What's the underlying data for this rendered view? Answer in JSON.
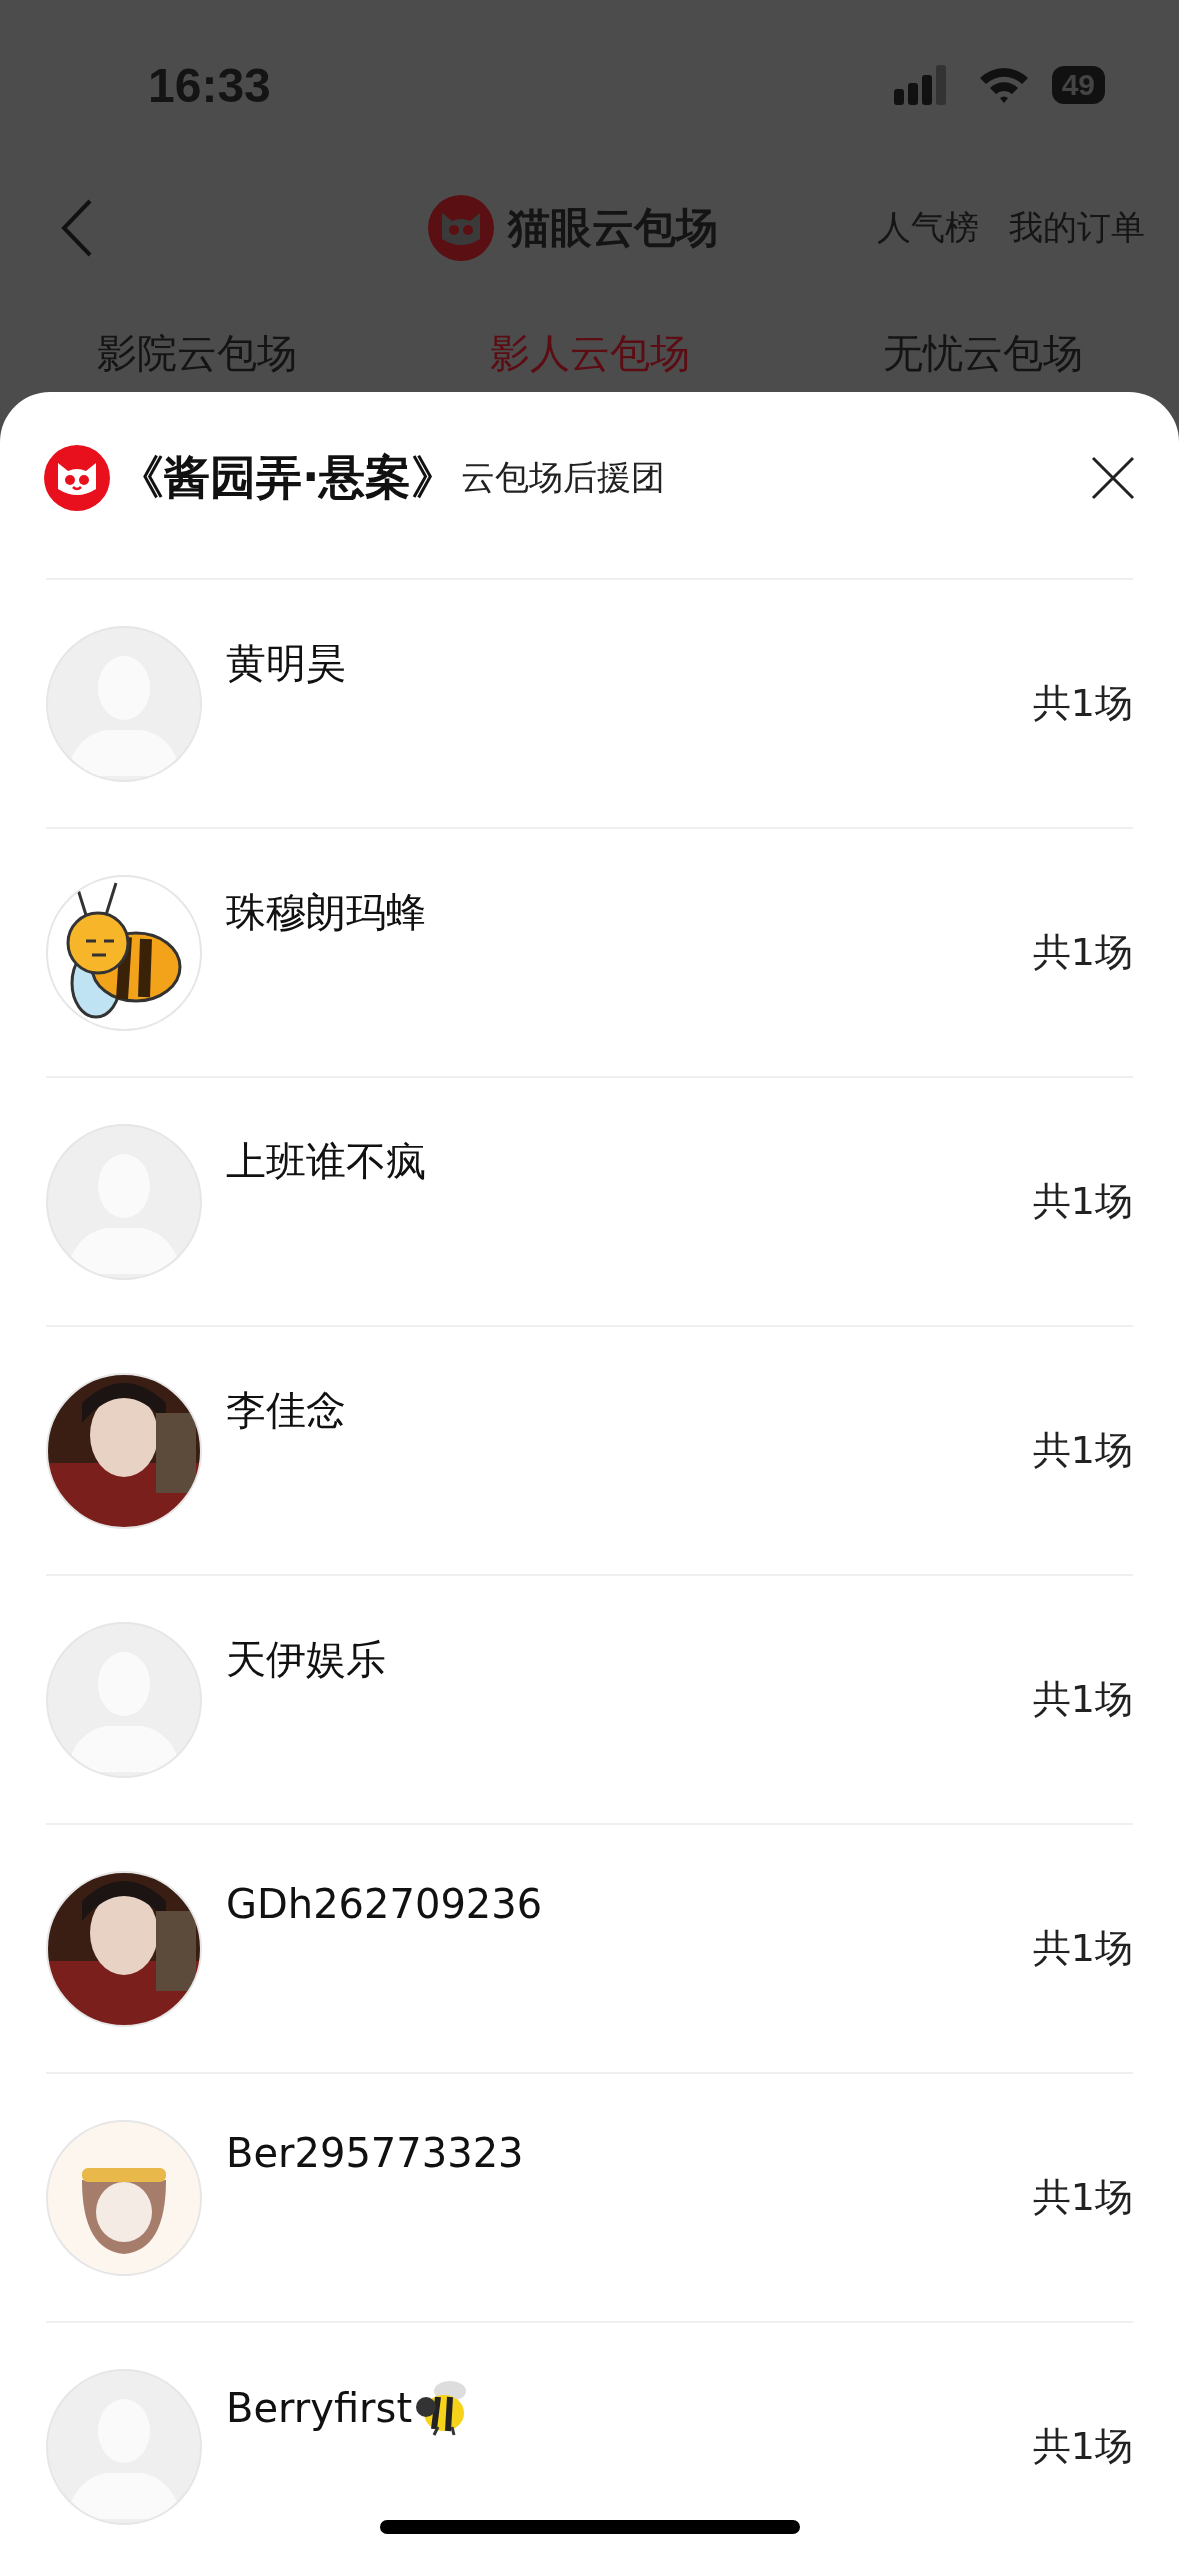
{
  "status_bar": {
    "time": "16:33",
    "battery": "49"
  },
  "header": {
    "title": "猫眼云包场",
    "links": [
      "人气榜",
      "我的订单"
    ]
  },
  "tabs": [
    {
      "label": "影院云包场",
      "selected": false
    },
    {
      "label": "影人云包场",
      "selected": true
    },
    {
      "label": "无忧云包场",
      "selected": false
    }
  ],
  "sheet": {
    "title": "《酱园弄·悬案》",
    "subtitle": "云包场后援团"
  },
  "rows": [
    {
      "name": "黄明昊",
      "count": "共1场",
      "kind": "default",
      "name_icon": false
    },
    {
      "name": "珠穆朗玛蜂",
      "count": "共1场",
      "kind": "bee",
      "name_icon": false
    },
    {
      "name": "上班谁不疯",
      "count": "共1场",
      "kind": "default",
      "name_icon": false
    },
    {
      "name": "李佳念",
      "count": "共1场",
      "kind": "picture",
      "name_icon": false
    },
    {
      "name": "天伊娱乐",
      "count": "共1场",
      "kind": "default",
      "name_icon": false
    },
    {
      "name": "GDh262709236",
      "count": "共1场",
      "kind": "picture",
      "name_icon": false
    },
    {
      "name": "Ber295773323",
      "count": "共1场",
      "kind": "monkey",
      "name_icon": false
    },
    {
      "name": "Berryfirst",
      "count": "共1场",
      "kind": "default",
      "name_icon": true
    }
  ]
}
